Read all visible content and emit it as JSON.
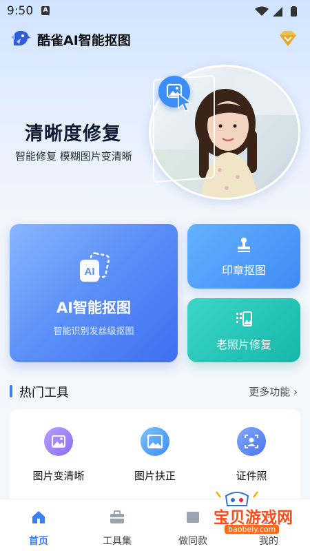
{
  "status": {
    "time": "9:50",
    "notif_icon": "a-notification-icon"
  },
  "header": {
    "title": "酷雀AI智能抠图"
  },
  "hero": {
    "title": "清晰度修复",
    "subtitle": "智能修复 模糊图片变清晰"
  },
  "cards": {
    "main": {
      "title": "AI智能抠图",
      "subtitle": "智能识别发丝级抠图",
      "icon_text": "AI"
    },
    "stamp": {
      "label": "印章抠图"
    },
    "photo": {
      "label": "老照片修复"
    }
  },
  "section": {
    "title": "热门工具",
    "more": "更多功能 ›"
  },
  "tools": [
    {
      "label": "图片变清晰",
      "icon": "image-enhance-icon"
    },
    {
      "label": "图片扶正",
      "icon": "image-straighten-icon"
    },
    {
      "label": "证件照",
      "icon": "id-photo-icon"
    }
  ],
  "nav": [
    {
      "label": "首页",
      "icon": "home-icon"
    },
    {
      "label": "工具集",
      "icon": "toolbox-icon"
    },
    {
      "label": "做同款",
      "icon": "template-icon"
    },
    {
      "label": "我的",
      "icon": "profile-icon"
    }
  ],
  "watermark": {
    "text": "宝贝游戏网",
    "url": "baobeiy.com"
  },
  "colors": {
    "accent": "#3b7ff5",
    "card_main": "#5a8ef7",
    "card_stamp": "#4b97f6",
    "card_photo": "#20c1b2"
  }
}
